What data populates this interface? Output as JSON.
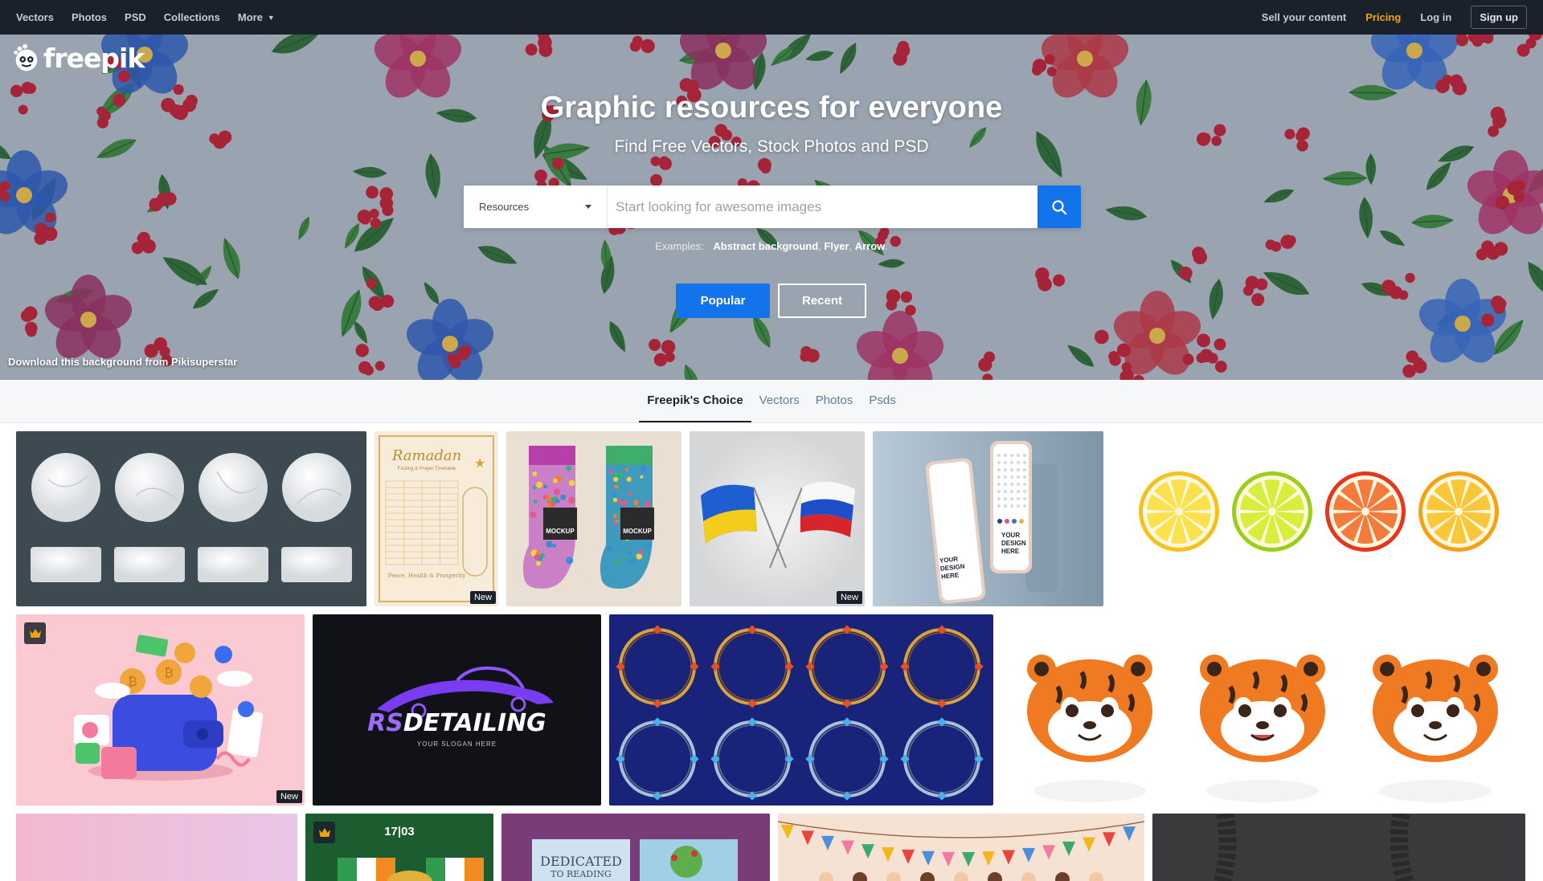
{
  "nav": {
    "left": [
      {
        "label": "Vectors"
      },
      {
        "label": "Photos"
      },
      {
        "label": "PSD"
      },
      {
        "label": "Collections"
      },
      {
        "label": "More"
      }
    ],
    "sell": "Sell your content",
    "pricing": "Pricing",
    "login": "Log in",
    "signup": "Sign up",
    "pricing_color": "#f3a40b"
  },
  "logo": {
    "text": "freepik"
  },
  "hero": {
    "title": "Graphic resources for everyone",
    "subtitle": "Find Free Vectors, Stock Photos and PSD",
    "search": {
      "category": "Resources",
      "placeholder": "Start looking for awesome images",
      "button_icon": "search-icon"
    },
    "examples_label": "Examples:",
    "examples": [
      "Abstract background",
      "Flyer",
      "Arrow"
    ],
    "popular": "Popular",
    "recent": "Recent",
    "credit_prefix": "Download this background from",
    "credit_author": "Pikisuperstar"
  },
  "tabs": [
    "Freepik's Choice",
    "Vectors",
    "Photos",
    "Psds"
  ],
  "active_tab": "Freepik's Choice",
  "grid": {
    "new_badge": "New",
    "tiles": {
      "ramadan_title": "Ramadan",
      "ramadan_sub": "Fasting & Prayer Timetable",
      "ramadan_footer": "Peace, Health & Prosperity",
      "sock_label": "MOCKUP",
      "phone_text": "YOUR DESIGN HERE",
      "rs_part1": "RS",
      "rs_part2": "DETAILING",
      "rs_slogan": "YOUR SLOGAN HERE",
      "stpat_date": "17|03",
      "book_title": "DEDICATED",
      "book_sub": "TO READING"
    }
  },
  "colors": {
    "accent": "#1273eb",
    "nav_bg": "#1a212b"
  }
}
